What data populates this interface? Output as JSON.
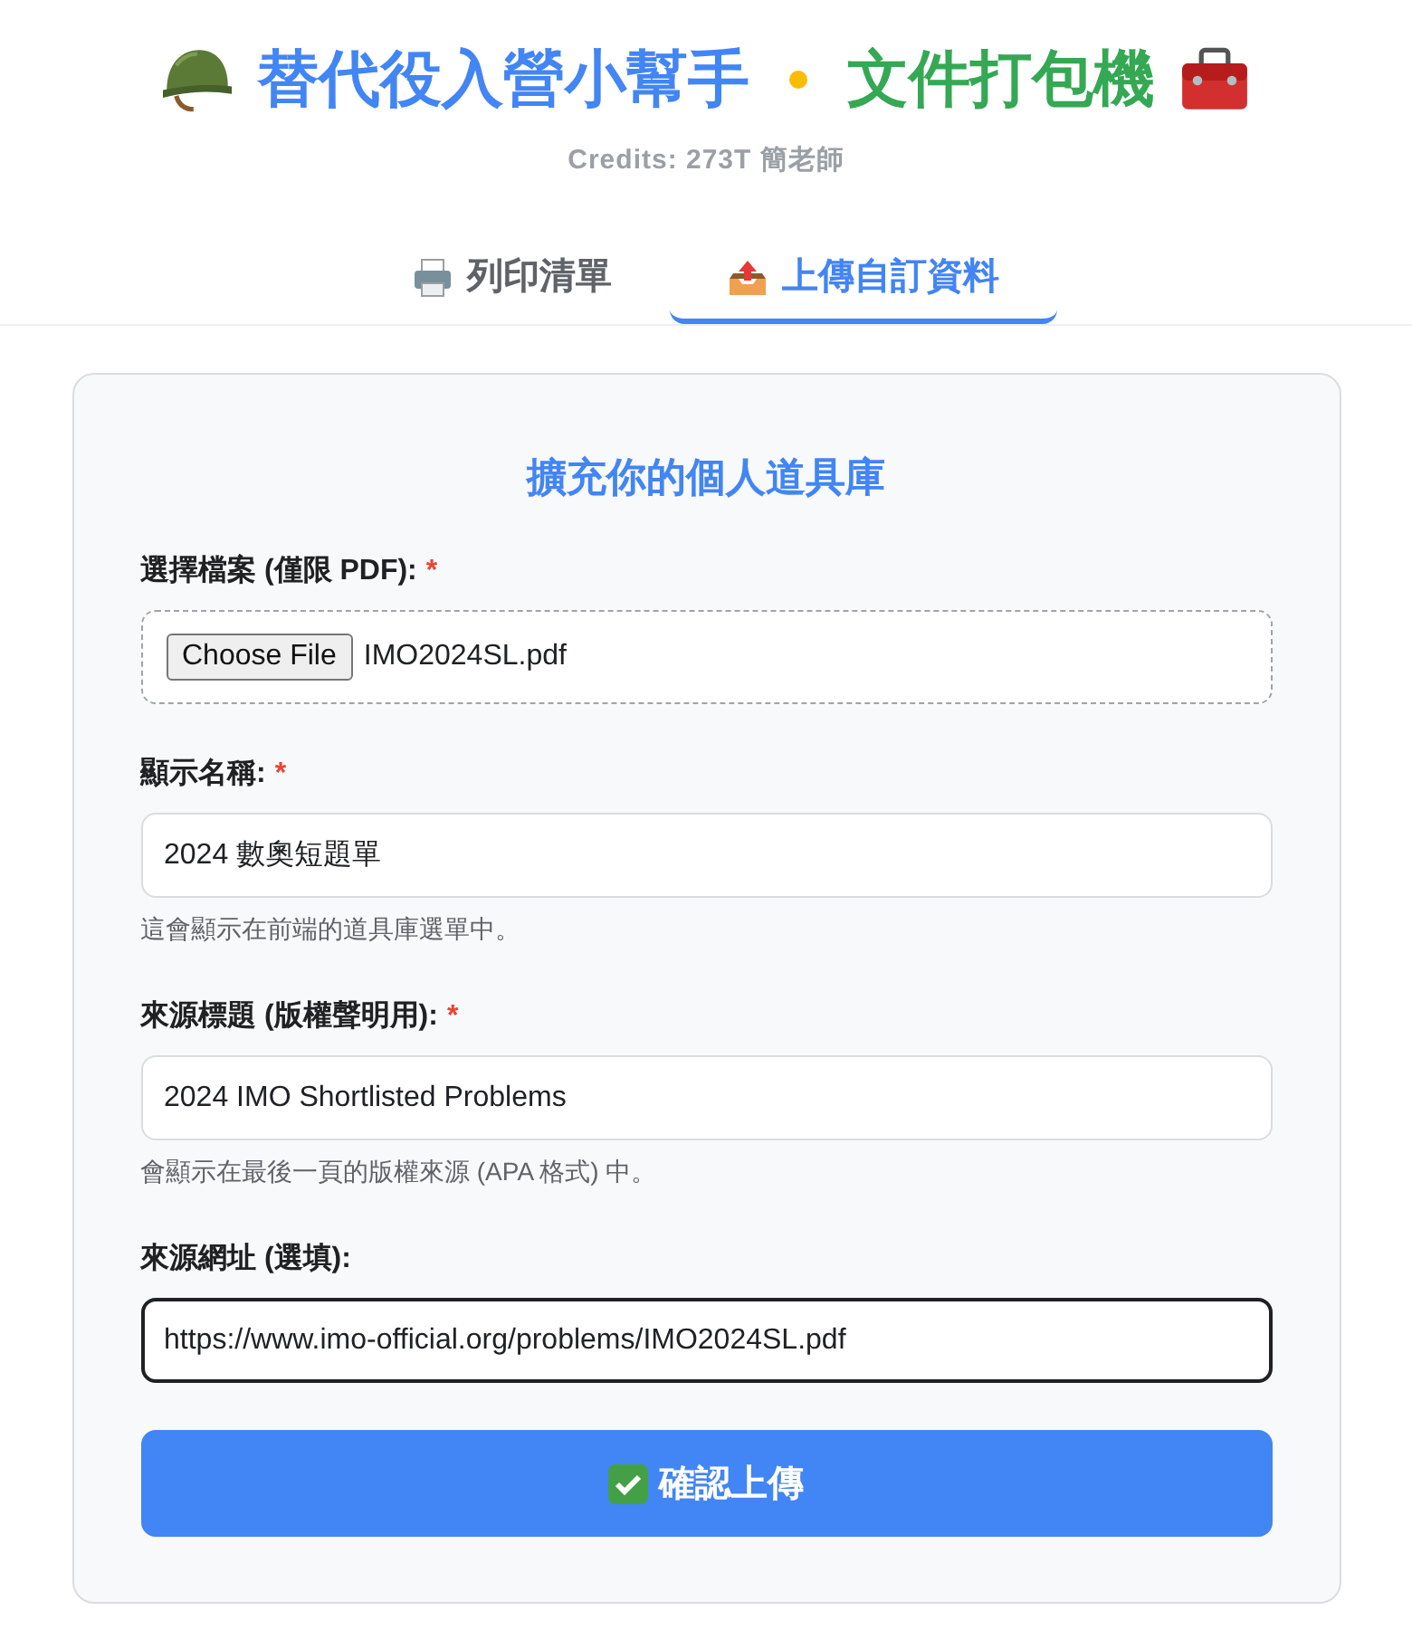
{
  "header": {
    "title_primary": "替代役入營小幫手",
    "title_secondary": "文件打包機",
    "credits": "Credits: 273T 簡老師"
  },
  "tabs": [
    {
      "label": "列印清單",
      "selected": false
    },
    {
      "label": "上傳自訂資料",
      "selected": true
    }
  ],
  "form": {
    "heading": "擴充你的個人道具庫",
    "fields": [
      {
        "kind": "file",
        "label": "選擇檔案 (僅限 PDF):",
        "required_mark": "*",
        "button": "Choose File",
        "value": "IMO2024SL.pdf"
      },
      {
        "kind": "text",
        "label": "顯示名稱:",
        "required_mark": "*",
        "value": "2024 數奧短題單",
        "focused": false,
        "hint": "這會顯示在前端的道具庫選單中。"
      },
      {
        "kind": "text",
        "label": "來源標題 (版權聲明用):",
        "required_mark": "*",
        "value": "2024 IMO Shortlisted Problems",
        "focused": false,
        "hint": "會顯示在最後一頁的版權來源 (APA 格式) 中。"
      },
      {
        "kind": "text",
        "label": "來源網址 (選填):",
        "value": "https://www.imo-official.org/problems/IMO2024SL.pdf",
        "focused": true
      }
    ],
    "submit": "確認上傳"
  }
}
